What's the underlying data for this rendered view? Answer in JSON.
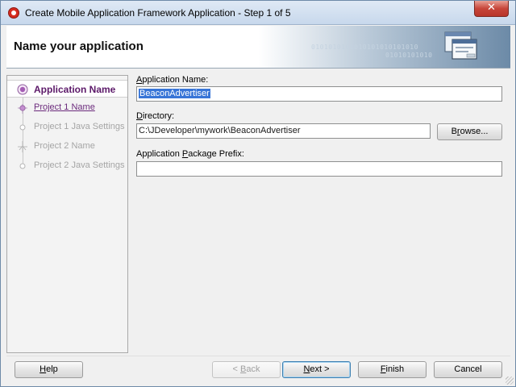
{
  "window": {
    "title": "Create Mobile Application Framework Application - Step 1 of 5",
    "close_glyph": "✕"
  },
  "banner": {
    "title": "Name your application",
    "decoration_binary": "0101010101010101010101010",
    "decoration_binary2": "01010101010",
    "icon": "windows-wizard-icon"
  },
  "nav": {
    "items": [
      {
        "label": "Application Name",
        "state": "selected",
        "icon": "current-step-icon"
      },
      {
        "label": "Project 1 Name",
        "state": "link",
        "icon": "project-node-icon"
      },
      {
        "label": "Project 1 Java Settings",
        "state": "disabled",
        "icon": "step-dot-icon"
      },
      {
        "label": "Project 2 Name",
        "state": "disabled",
        "icon": "project-node-icon"
      },
      {
        "label": "Project 2 Java Settings",
        "state": "disabled",
        "icon": "step-dot-icon"
      }
    ]
  },
  "form": {
    "app_name": {
      "label_mnemonic": "A",
      "label_rest": "pplication Name:",
      "value": "BeaconAdvertiser"
    },
    "directory": {
      "label_mnemonic": "D",
      "label_rest": "irectory:",
      "value": "C:\\JDeveloper\\mywork\\BeaconAdvertiser"
    },
    "browse": {
      "label_pre": "B",
      "label_mnemonic": "r",
      "label_rest": "owse..."
    },
    "package_prefix": {
      "label_pre": "Application ",
      "label_mnemonic": "P",
      "label_rest": "ackage Prefix:",
      "value": ""
    }
  },
  "footer": {
    "help": {
      "mnemonic": "H",
      "rest": "elp"
    },
    "back": {
      "pre": "< ",
      "mnemonic": "B",
      "rest": "ack",
      "enabled": false
    },
    "next": {
      "mnemonic": "N",
      "rest": "ext >"
    },
    "finish": {
      "mnemonic": "F",
      "rest": "inish"
    },
    "cancel": {
      "label": "Cancel"
    }
  },
  "colors": {
    "nav_selected_text": "#5c1969",
    "nav_link_text": "#6b2a7c",
    "selection_bg": "#3875d7",
    "close_button": "#c7463a"
  }
}
